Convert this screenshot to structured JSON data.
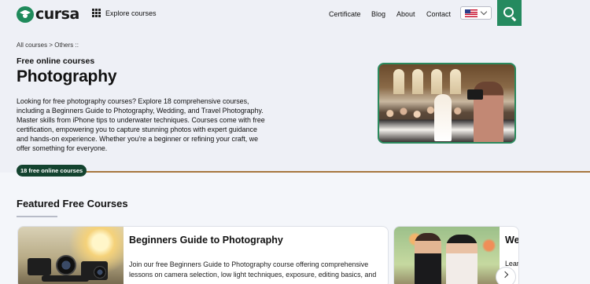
{
  "header": {
    "logo_text": "cursa",
    "explore_label": "Explore courses",
    "nav": [
      "Certificate",
      "Blog",
      "About",
      "Contact"
    ],
    "language_flag": "us-flag-icon"
  },
  "hero": {
    "breadcrumb": "All courses > Others ::",
    "eyebrow": "Free online courses",
    "title": "Photography",
    "description": "Looking for free photography courses? Explore 18 comprehensive courses, including a Beginners Guide to Photography, Wedding, and Travel Photography. Master skills from iPhone tips to underwater techniques. Courses come with free certification, empowering you to capture stunning photos with expert guidance and hands-on experience. Whether you're a beginner or refining your craft, we offer something for everyone.",
    "count_pill": "18 free online courses"
  },
  "featured": {
    "title": "Featured Free Courses",
    "cards": [
      {
        "title": "Beginners Guide to Photography",
        "text": "Join our free Beginners Guide to Photography course offering comprehensive lessons on camera selection, low light techniques, exposure, editing basics, and"
      },
      {
        "title": "We",
        "text": "Learn"
      }
    ]
  },
  "colors": {
    "brand_green": "#258a5f",
    "pill_dark_green": "#13432f",
    "divider_brown": "#a7773f"
  }
}
